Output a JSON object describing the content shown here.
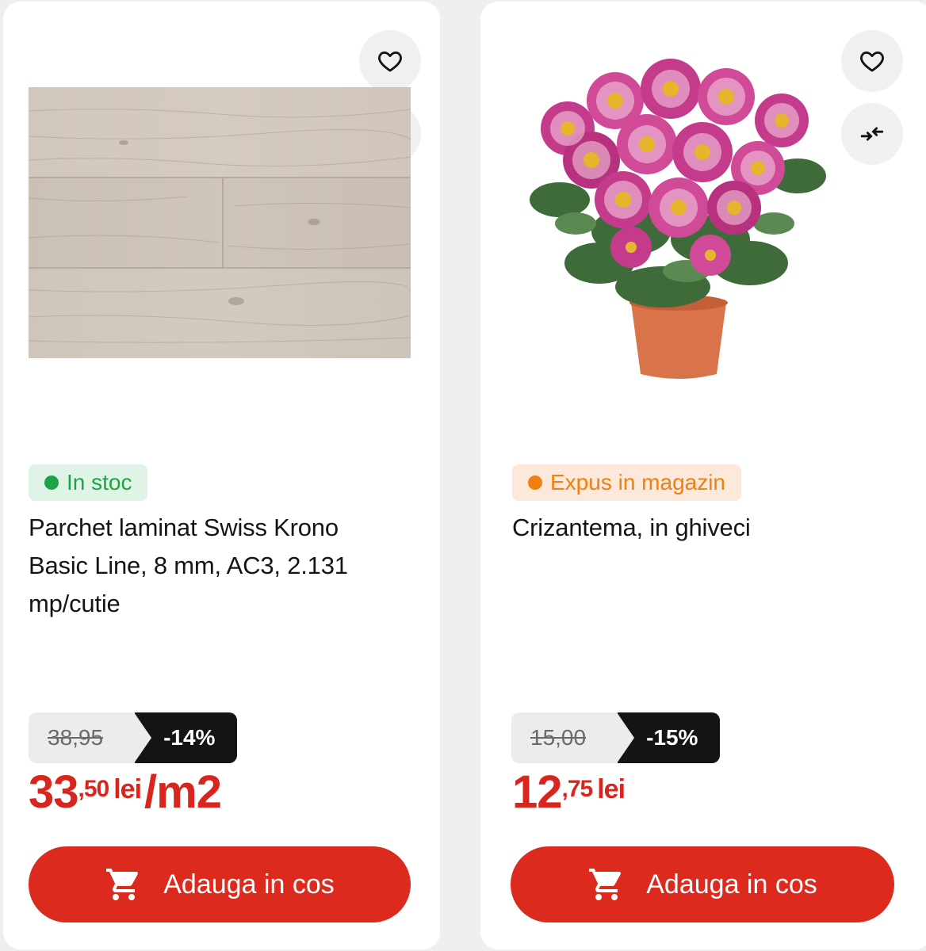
{
  "products": [
    {
      "image_icon": "laminate-floor-image",
      "stock_label": "In stoc",
      "stock_color": "#1ea446",
      "title": "Parchet laminat Swiss Krono Basic Line, 8 mm, AC3, 2.131 mp/cutie",
      "old_price": "38,95",
      "discount": "-14%",
      "price_int": "33",
      "price_dec": ",50",
      "currency": "lei",
      "unit": "/m2",
      "cart_label": "Adauga in cos"
    },
    {
      "image_icon": "chrysanthemum-pot-image",
      "stock_label": "Expus in magazin",
      "stock_color": "#f08010",
      "title": "Crizantema, in ghiveci",
      "old_price": "15,00",
      "discount": "-15%",
      "price_int": "12",
      "price_dec": ",75",
      "currency": "lei",
      "unit": "",
      "cart_label": "Adauga in cos"
    }
  ],
  "colors": {
    "accent": "#dc2a1e",
    "price": "#d8261f",
    "discount_bg": "#141414"
  }
}
